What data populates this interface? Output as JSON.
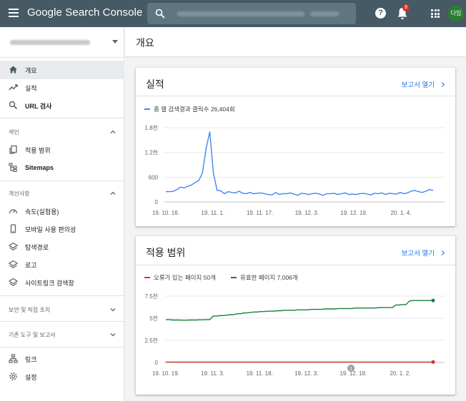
{
  "app": {
    "title_google": "Google",
    "title_product": "Search Console"
  },
  "header": {
    "notification_count": "9",
    "avatar_initials": "다임",
    "help_label": "?"
  },
  "colors": {
    "topbar": "#455a64",
    "accent": "#1a73e8",
    "clicks_series": "#4285f4",
    "error_series": "#d93025",
    "valid_series": "#188038"
  },
  "sidebar": {
    "main_items": [
      {
        "label": "개요",
        "icon": "home-icon",
        "active": true
      },
      {
        "label": "실적",
        "icon": "trending-icon"
      },
      {
        "label": "URL 검사",
        "icon": "search-icon"
      }
    ],
    "index_section": {
      "title": "색인",
      "items": [
        {
          "label": "적용 범위",
          "icon": "file-copy-icon"
        },
        {
          "label": "Sitemaps",
          "icon": "sitemap-icon"
        }
      ]
    },
    "enhance_section": {
      "title": "개선사항",
      "items": [
        {
          "label": "속도(실험용)",
          "icon": "speed-icon"
        },
        {
          "label": "모바일 사용 편의성",
          "icon": "phone-icon"
        },
        {
          "label": "탐색경로",
          "icon": "layers-icon"
        },
        {
          "label": "로고",
          "icon": "layers-icon"
        },
        {
          "label": "사이트링크 검색창",
          "icon": "layers-icon"
        }
      ]
    },
    "security_section": {
      "title": "보안 및 직접 조치"
    },
    "legacy_section": {
      "title": "기존 도구 및 보고서"
    },
    "bottom_items": [
      {
        "label": "링크",
        "icon": "links-icon"
      },
      {
        "label": "설정",
        "icon": "settings-icon"
      }
    ]
  },
  "main": {
    "page_title": "개요",
    "performance": {
      "title": "실적",
      "link": "보고서 열기",
      "legend": "총 웹 검색결과 클릭수 26,404회"
    },
    "coverage": {
      "title": "적용 범위",
      "link": "보고서 열기",
      "legend_error": "오류가 있는 페이지 50개",
      "legend_valid": "유효한 페이지 7,006개",
      "annotation": "1"
    }
  },
  "chart_data": [
    {
      "type": "line",
      "title": "총 웹 검색결과 클릭수 26,404회",
      "x_labels": [
        "19. 10. 16.",
        "19. 11. 1.",
        "19. 11. 17.",
        "19. 12. 3.",
        "19. 12. 19.",
        "20. 1. 4."
      ],
      "y_ticks": [
        "0",
        "600",
        "1.2천",
        "1.8천"
      ],
      "ylim": [
        0,
        1800
      ],
      "series": [
        {
          "values": [
            250,
            250,
            255,
            300,
            360,
            340,
            380,
            410,
            470,
            520,
            700,
            1300,
            1700,
            700,
            280,
            270,
            200,
            250,
            230,
            220,
            260,
            210,
            200,
            230,
            200,
            210,
            220,
            200,
            180,
            170,
            230,
            180,
            200,
            200,
            220,
            190,
            160,
            210,
            200,
            180,
            200,
            210,
            190,
            160,
            200,
            200,
            210,
            180,
            200,
            220,
            180,
            190,
            180,
            200,
            210,
            190,
            170,
            210,
            200,
            220,
            180,
            210,
            200,
            190,
            230,
            200,
            220,
            260,
            280,
            250,
            230,
            260,
            300,
            280
          ]
        }
      ]
    },
    {
      "type": "line",
      "x_labels": [
        "19. 10. 19.",
        "19. 11. 3.",
        "19. 11. 18.",
        "19. 12. 3.",
        "19. 12. 18.",
        "20. 1. 2."
      ],
      "y_ticks": [
        "0",
        "2.5천",
        "5천",
        "7.5천"
      ],
      "ylim": [
        0,
        7500
      ],
      "series": [
        {
          "name": "오류가 있는 페이지 50개",
          "values": [
            50,
            50,
            50,
            50,
            50,
            50,
            50,
            50,
            50,
            50,
            50,
            50,
            50,
            50,
            50,
            50,
            50,
            50,
            50,
            50,
            50,
            50,
            50,
            50,
            50,
            50,
            50,
            50,
            50,
            50,
            50,
            50,
            50,
            50,
            50,
            50,
            50,
            50,
            50,
            50,
            50,
            50,
            50,
            50,
            50,
            50,
            50,
            50,
            50,
            50,
            50,
            50,
            50,
            50,
            50,
            50,
            50,
            50,
            50,
            50,
            50,
            50,
            50,
            50,
            50,
            50,
            50,
            50,
            50,
            50,
            50,
            50,
            50,
            50,
            50,
            50,
            50,
            50,
            50,
            50,
            50
          ]
        },
        {
          "name": "유효한 페이지 7,006개",
          "values": [
            4850,
            4850,
            4800,
            4800,
            4800,
            4780,
            4780,
            4800,
            4800,
            4800,
            4820,
            4820,
            4850,
            4850,
            5250,
            5250,
            5300,
            5300,
            5350,
            5400,
            5400,
            5500,
            5500,
            5600,
            5600,
            5650,
            5700,
            5700,
            5750,
            5750,
            5800,
            5800,
            5800,
            5850,
            5850,
            5900,
            5900,
            5900,
            5900,
            5950,
            5950,
            5950,
            5950,
            6000,
            6000,
            6000,
            6000,
            6050,
            6050,
            6050,
            6050,
            6100,
            6100,
            6100,
            6100,
            6100,
            6150,
            6150,
            6150,
            6150,
            6150,
            6150,
            6150,
            6200,
            6200,
            6200,
            6200,
            6200,
            6500,
            6500,
            6550,
            6550,
            6950,
            7000,
            7000,
            7000,
            7000,
            7000,
            7000,
            7006
          ]
        }
      ]
    }
  ]
}
